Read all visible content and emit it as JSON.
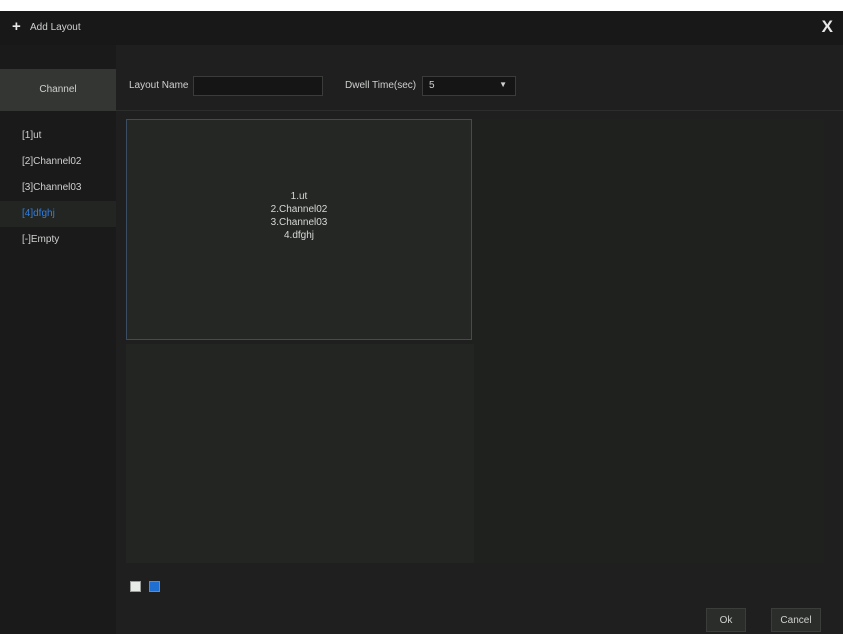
{
  "titlebar": {
    "icon": "plus-icon",
    "plus_glyph": "+",
    "title": "Add Layout",
    "close_glyph": "X"
  },
  "sidebar": {
    "header": "Channel",
    "items": [
      {
        "label": "[1]ut",
        "selected": false
      },
      {
        "label": "[2]Channel02",
        "selected": false
      },
      {
        "label": "[3]Channel03",
        "selected": false
      },
      {
        "label": "[4]dfghj",
        "selected": true
      },
      {
        "label": "[-]Empty",
        "selected": false
      }
    ]
  },
  "form": {
    "layout_name_label": "Layout Name",
    "layout_name_value": "",
    "dwell_time_label": "Dwell Time(sec)",
    "dwell_time_value": "5",
    "dwell_time_chevron": "▼"
  },
  "layout": {
    "cell1_lines": [
      "1.ut",
      "2.Channel02",
      "3.Channel03",
      "4.dfghj"
    ]
  },
  "swatches": [
    {
      "name": "white-swatch",
      "color": "#e9ebe9"
    },
    {
      "name": "blue-swatch",
      "color": "#1f6fd2"
    }
  ],
  "footer": {
    "ok_label": "Ok",
    "cancel_label": "Cancel"
  },
  "colors": {
    "accent": "#2f7fe0",
    "background": "#1e1f1e"
  }
}
